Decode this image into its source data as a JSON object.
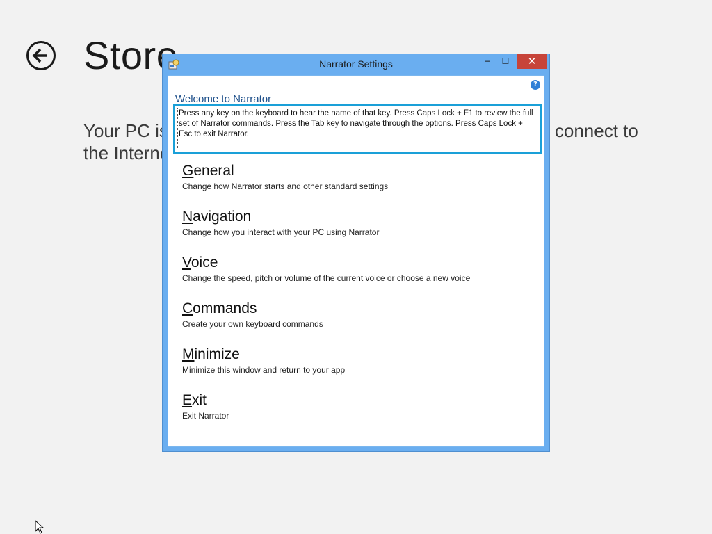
{
  "store": {
    "title": "Store",
    "message": "Your PC is not connected to the Internet. To use the Store, connect to the Internet and then try again."
  },
  "window": {
    "title": "Narrator Settings",
    "controls": {
      "minimize": "−",
      "maximize": "☐",
      "close": "✕"
    },
    "help_icon": "?",
    "welcome": "Welcome to Narrator",
    "intro": "Press any key on the keyboard to hear the name of that key.  Press Caps Lock + F1 to review the full set of Narrator commands.  Press the Tab key to navigate through the options.  Press Caps Lock + Esc to exit Narrator.",
    "menu": [
      {
        "access_key": "G",
        "rest": "eneral",
        "desc": "Change how Narrator starts and other standard settings"
      },
      {
        "access_key": "N",
        "rest": "avigation",
        "desc": "Change how you interact with your PC using Narrator"
      },
      {
        "access_key": "V",
        "rest": "oice",
        "desc": "Change the speed, pitch or volume of the current voice or choose a new voice"
      },
      {
        "access_key": "C",
        "rest": "ommands",
        "desc": "Create your own keyboard commands"
      },
      {
        "access_key": "M",
        "rest": "inimize",
        "desc": "Minimize this window and return to your app"
      },
      {
        "access_key": "E",
        "rest": "xit",
        "desc": "Exit Narrator"
      }
    ]
  },
  "colors": {
    "window_frame": "#6aaef0",
    "close_button": "#c7443a",
    "focus_border": "#1aa0d8",
    "welcome_text": "#1d4f8a"
  }
}
